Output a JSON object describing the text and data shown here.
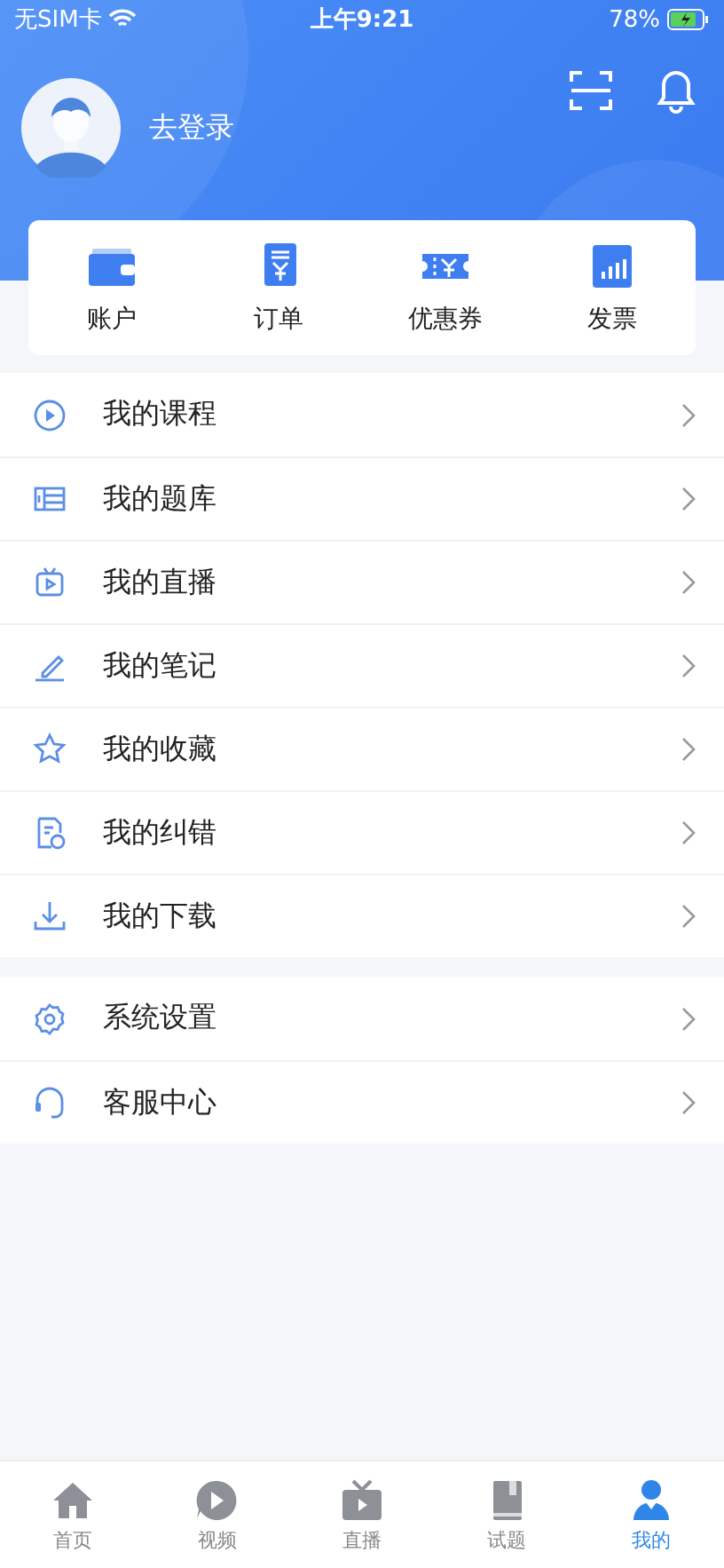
{
  "status_bar": {
    "carrier": "无SIM卡",
    "time": "上午9:21",
    "battery": "78%"
  },
  "profile": {
    "login": "去登录"
  },
  "shortcuts": [
    {
      "kind": "wallet",
      "label": "账户"
    },
    {
      "kind": "receipt",
      "label": "订单"
    },
    {
      "kind": "coupon",
      "label": "优惠券"
    },
    {
      "kind": "invoice",
      "label": "发票"
    }
  ],
  "menu_groups": [
    [
      {
        "kind": "play",
        "label": "我的课程"
      },
      {
        "kind": "bank",
        "label": "我的题库"
      },
      {
        "kind": "tv",
        "label": "我的直播"
      },
      {
        "kind": "pen",
        "label": "我的笔记"
      },
      {
        "kind": "star",
        "label": "我的收藏"
      },
      {
        "kind": "doc",
        "label": "我的纠错"
      },
      {
        "kind": "download",
        "label": "我的下载"
      }
    ],
    [
      {
        "kind": "gear",
        "label": "系统设置"
      },
      {
        "kind": "headset",
        "label": "客服中心"
      }
    ]
  ],
  "tab_bar": [
    {
      "kind": "home",
      "label": "首页",
      "selected": false
    },
    {
      "kind": "video",
      "label": "视频",
      "selected": false
    },
    {
      "kind": "live",
      "label": "直播",
      "selected": false
    },
    {
      "kind": "book",
      "label": "试题",
      "selected": false
    },
    {
      "kind": "me",
      "label": "我的",
      "selected": true
    }
  ]
}
